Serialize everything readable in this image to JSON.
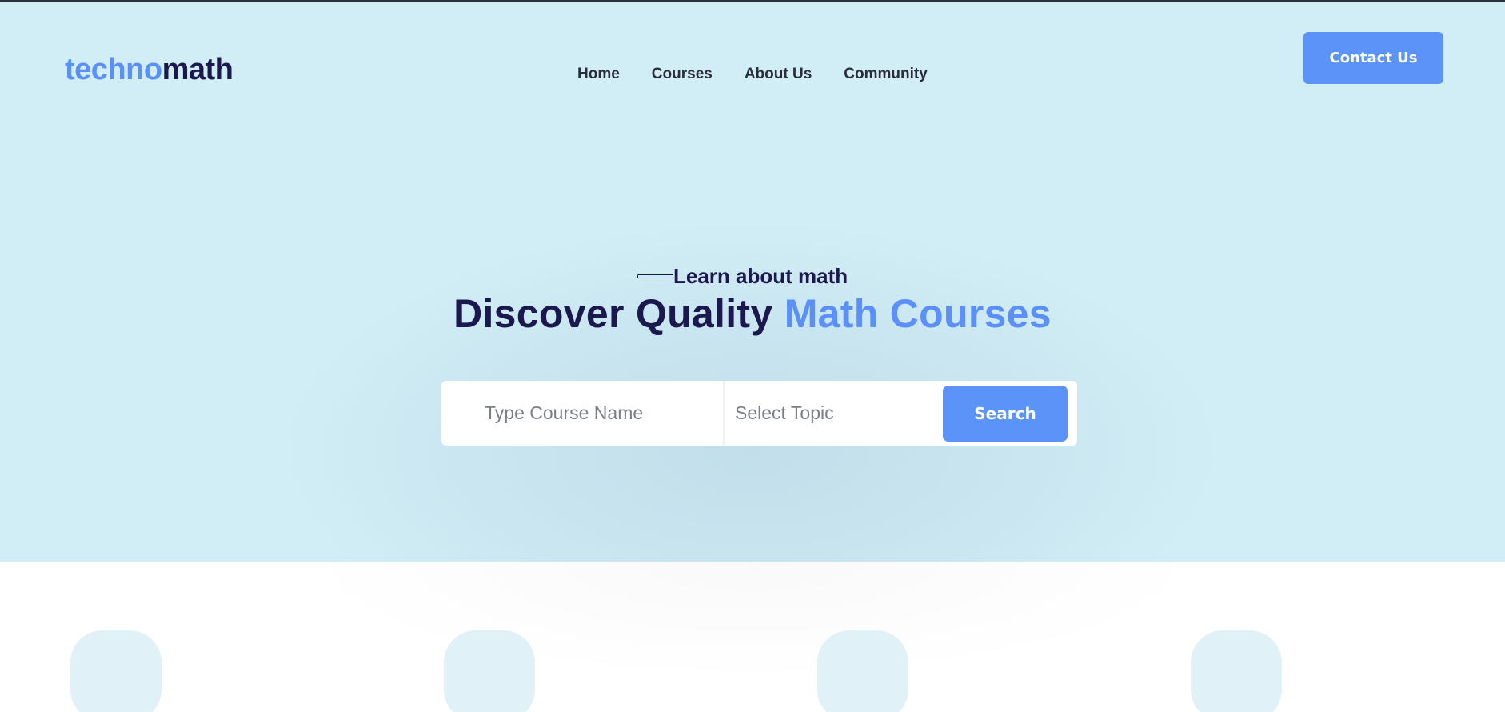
{
  "brand": {
    "logo_part1": "techno",
    "logo_part2": "math"
  },
  "nav": {
    "items": [
      {
        "label": "Home"
      },
      {
        "label": "Courses"
      },
      {
        "label": "About Us"
      },
      {
        "label": "Community"
      }
    ],
    "contact_label": "Contact Us"
  },
  "hero": {
    "eyebrow": "Learn about math",
    "headline_part1": "Discover Quality ",
    "headline_part2": "Math Courses"
  },
  "search": {
    "course_placeholder": "Type Course Name",
    "topic_placeholder": "Select Topic",
    "button_label": "Search"
  },
  "colors": {
    "hero_bg": "#d1edf5",
    "accent": "#5b8ff9",
    "navy": "#1b1850",
    "feature_icon_bg": "#e0f1f7"
  },
  "features": {
    "icons": [
      "feature-icon-1",
      "feature-icon-2",
      "feature-icon-3",
      "feature-icon-4"
    ]
  }
}
